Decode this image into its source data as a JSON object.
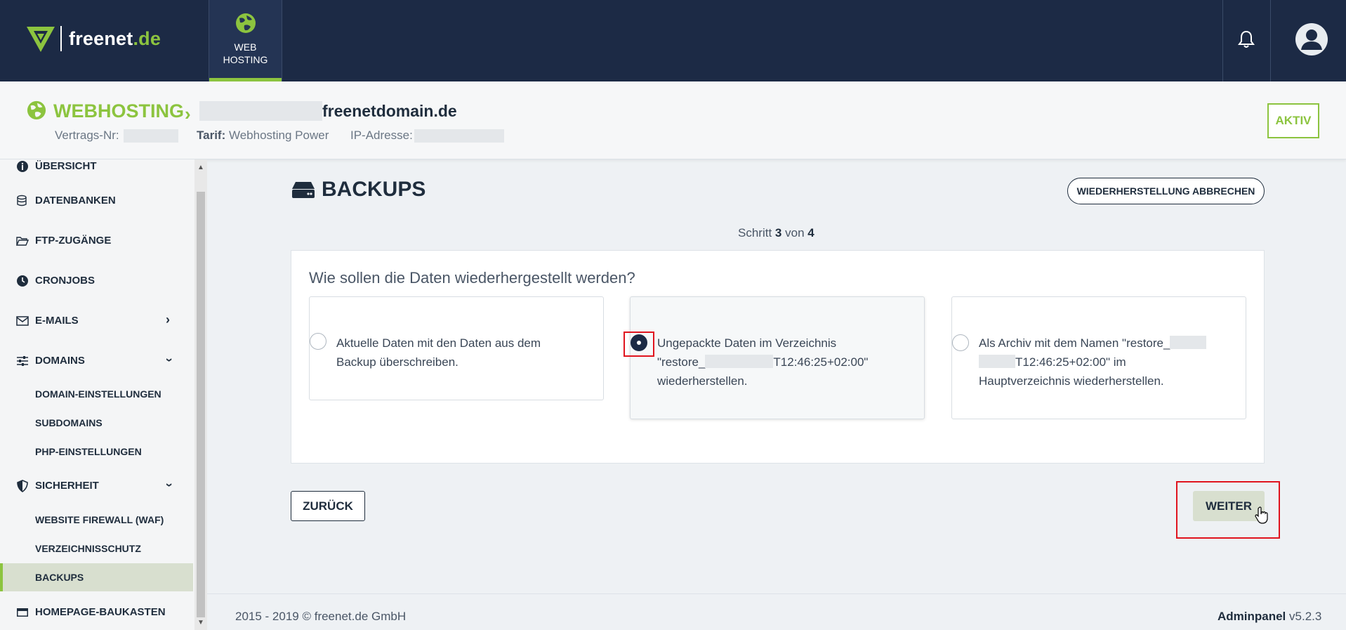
{
  "brand": {
    "name": "freenet",
    "tld": ".de"
  },
  "top_nav": {
    "tab_line1": "WEB",
    "tab_line2": "HOSTING"
  },
  "header": {
    "section": "WEBHOSTING",
    "domain": "freenetdomain.de",
    "contract_label": "Vertrags-Nr:",
    "tarif_label": "Tarif:",
    "tarif_value": "Webhosting Power",
    "ip_label": "IP-Adresse:",
    "status": "AKTIV"
  },
  "sidebar": {
    "items": [
      {
        "label": "ÜBERSICHT"
      },
      {
        "label": "DATENBANKEN"
      },
      {
        "label": "FTP-ZUGÄNGE"
      },
      {
        "label": "CRONJOBS"
      },
      {
        "label": "E-MAILS"
      },
      {
        "label": "DOMAINS"
      },
      {
        "label": "SICHERHEIT"
      },
      {
        "label": "HOMEPAGE-BAUKASTEN"
      }
    ],
    "domains_sub": [
      "DOMAIN-EINSTELLUNGEN",
      "SUBDOMAINS",
      "PHP-EINSTELLUNGEN"
    ],
    "security_sub": [
      "WEBSITE FIREWALL (WAF)",
      "VERZEICHNISSCHUTZ",
      "BACKUPS"
    ]
  },
  "page": {
    "title": "BACKUPS",
    "cancel_label": "WIEDERHERSTELLUNG ABBRECHEN",
    "step_prefix": "Schritt",
    "step_current": "3",
    "step_of": "von",
    "step_total": "4",
    "question": "Wie sollen die Daten wiederhergestellt werden?",
    "options": [
      {
        "line1": "Aktuelle Daten mit den Daten aus dem",
        "line2": "Backup überschreiben.",
        "line3": ""
      },
      {
        "line1": "Ungepackte Daten im Verzeichnis",
        "line2a": "\"restore_",
        "line2b": "T12:46:25+02:00\"",
        "line3": "wiederherstellen."
      },
      {
        "line1": "Als Archiv mit dem Namen \"restore_",
        "line2": "T12:46:25+02:00\" im",
        "line3": "Hauptverzeichnis wiederherstellen."
      }
    ],
    "selected_option": 2,
    "back_label": "ZURÜCK",
    "next_label": "WEITER"
  },
  "footer": {
    "copyright": "2015 - 2019 © freenet.de GmbH",
    "panel_label": "Adminpanel",
    "version": "v5.2.3"
  }
}
